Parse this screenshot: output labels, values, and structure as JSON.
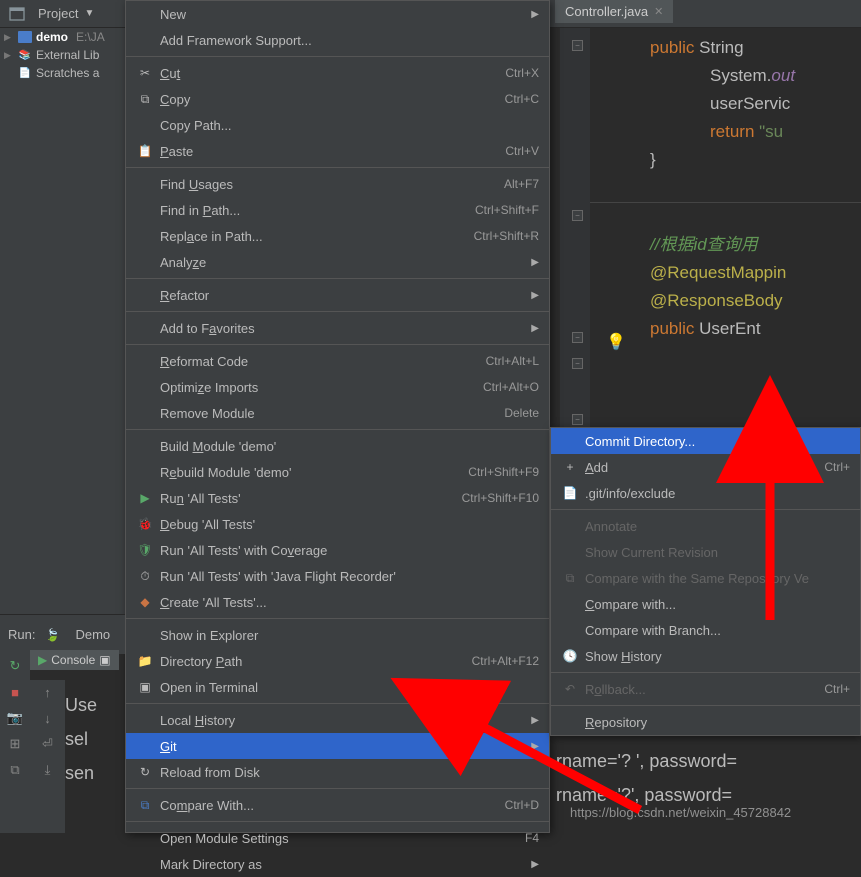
{
  "project": {
    "label": "Project"
  },
  "tree": {
    "demo": "demo",
    "demo_path": "E:\\JA",
    "external": "External Lib",
    "scratches": "Scratches a"
  },
  "editor_tab": {
    "label": "Controller.java"
  },
  "code": {
    "l1a": "public",
    "l1b": " String ",
    "l2a": "System.",
    "l2b": "out",
    "l3": "userServic",
    "l4a": "return",
    "l4b": " \"su",
    "l5": "}",
    "l6": "//根据id查询用",
    "l7": "@RequestMappin",
    "l8": "@ResponseBody",
    "l9a": "public",
    "l9b": " UserEnt"
  },
  "menu1": {
    "new": "New",
    "add_framework": "Add Framework Support...",
    "cut": "Cut",
    "cut_sc": "Ctrl+X",
    "copy": "Copy",
    "copy_sc": "Ctrl+C",
    "copy_path": "Copy Path...",
    "paste": "Paste",
    "paste_sc": "Ctrl+V",
    "find_usages": "Find Usages",
    "find_usages_sc": "Alt+F7",
    "find_in_path": "Find in Path...",
    "find_in_path_sc": "Ctrl+Shift+F",
    "replace_in_path": "Replace in Path...",
    "replace_in_path_sc": "Ctrl+Shift+R",
    "analyze": "Analyze",
    "refactor": "Refactor",
    "add_favorites": "Add to Favorites",
    "reformat": "Reformat Code",
    "reformat_sc": "Ctrl+Alt+L",
    "optimize": "Optimize Imports",
    "optimize_sc": "Ctrl+Alt+O",
    "remove_module": "Remove Module",
    "remove_module_sc": "Delete",
    "build": "Build Module 'demo'",
    "rebuild": "Rebuild Module 'demo'",
    "rebuild_sc": "Ctrl+Shift+F9",
    "run": "Run 'All Tests'",
    "run_sc": "Ctrl+Shift+F10",
    "debug": "Debug 'All Tests'",
    "coverage": "Run 'All Tests' with Coverage",
    "jfr": "Run 'All Tests' with 'Java Flight Recorder'",
    "create_tests": "Create 'All Tests'...",
    "show_explorer": "Show in Explorer",
    "dir_path": "Directory Path",
    "dir_path_sc": "Ctrl+Alt+F12",
    "open_terminal": "Open in Terminal",
    "local_history": "Local History",
    "git": "Git",
    "reload": "Reload from Disk",
    "compare": "Compare With...",
    "compare_sc": "Ctrl+D",
    "module_settings": "Open Module Settings",
    "module_settings_sc": "F4",
    "mark_dir": "Mark Directory as"
  },
  "menu2": {
    "commit": "Commit Directory...",
    "add": "Add",
    "add_sc": "Ctrl+",
    "exclude": ".git/info/exclude",
    "annotate": "Annotate",
    "show_rev": "Show Current Revision",
    "compare_repo": "Compare with the Same Repository Ve",
    "compare_with": "Compare with...",
    "compare_branch": "Compare with Branch...",
    "show_history": "Show History",
    "rollback": "Rollback...",
    "rollback_sc": "Ctrl+",
    "repository": "Repository"
  },
  "run": {
    "label": "Run:",
    "config": "Demo"
  },
  "console": {
    "tab": "Console",
    "l1": "Use",
    "l2": "sel",
    "l3": "sen",
    "r1": "rname='? ', password=",
    "r2": "rname='?', password="
  },
  "watermark": "https://blog.csdn.net/weixin_45728842"
}
